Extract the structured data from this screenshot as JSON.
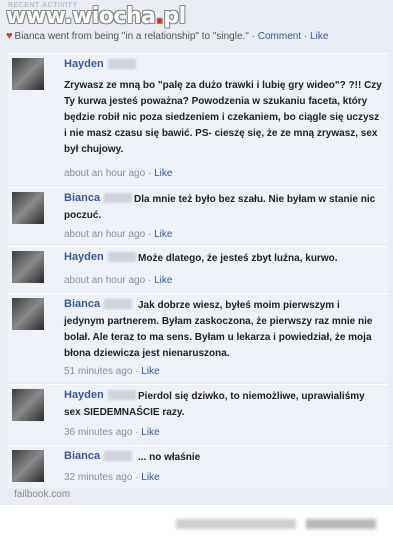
{
  "watermark": {
    "prefix": "www.",
    "name": "wiocha",
    "dot": ".",
    "tld": "pl"
  },
  "recent_label": "RECENT ACTIVITY",
  "story": {
    "text": "Bianca went from being \"in a relationship\" to \"single.\"",
    "comment_link": "Comment",
    "like_link": "Like",
    "separator": "·"
  },
  "comments": [
    {
      "author": "Hayden",
      "text": "Zrywasz ze mną bo \"palę za dużo trawki i lubię gry wideo\"? ?!! Czy Ty kurwa jesteś poważna? Powodzenia w szukaniu faceta, który będzie robił nic poza siedzeniem i czekaniem, bo ciągle się uczysz i nie masz czasu się bawić. PS- cieszę się, że ze mną zrywasz, sex był chujowy.",
      "time": "about an hour ago",
      "like": "Like"
    },
    {
      "author": "Bianca",
      "text": "Dla mnie też było bez szału. Nie byłam w stanie nic poczuć.",
      "time": "about an hour ago",
      "like": "Like"
    },
    {
      "author": "Hayden",
      "text": "Może dlatego, że jesteś zbyt luźna, kurwo.",
      "time": "about an hour ago",
      "like": "Like"
    },
    {
      "author": "Bianca",
      "text": "Jak dobrze wiesz, byłeś moim pierwszym i jedynym partnerem. Byłam zaskoczona, że pierwszy raz mnie nie bolał. Ale teraz to ma sens. Byłam u lekarza i powiedział, że moja błona dziewicza jest nienaruszona.",
      "time": "51 minutes ago",
      "like": "Like"
    },
    {
      "author": "Hayden",
      "text": "Pierdol się dziwko, to niemożliwe, uprawialiśmy sex SIEDEMNAŚCIE razy.",
      "time": "36 minutes ago",
      "like": "Like"
    },
    {
      "author": "Bianca",
      "text": "... no właśnie",
      "time": "32 minutes ago",
      "like": "Like"
    }
  ],
  "footer": "failbook.com"
}
